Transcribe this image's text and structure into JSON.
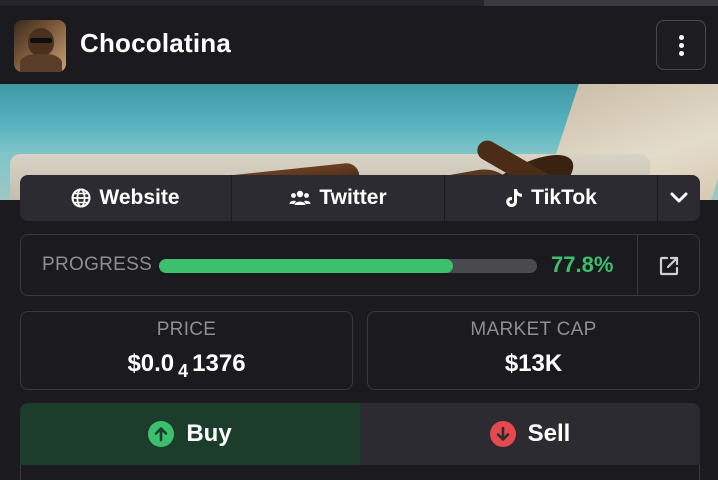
{
  "header": {
    "title": "Chocolatina",
    "menu_icon": "kebab-vertical-icon"
  },
  "socials": {
    "website": {
      "label": "Website",
      "icon": "globe-icon"
    },
    "twitter": {
      "label": "Twitter",
      "icon": "users-icon"
    },
    "tiktok": {
      "label": "TikTok",
      "icon": "tiktok-icon"
    },
    "more_icon": "chevron-down-icon"
  },
  "progress": {
    "label": "PROGRESS",
    "value_text": "77.8%",
    "fraction": 0.778,
    "external_icon": "external-link-icon"
  },
  "stats": {
    "price": {
      "label": "PRICE",
      "value_main": "$0.0",
      "value_sub": "4",
      "value_rest": "1376"
    },
    "market_cap": {
      "label": "MARKET CAP",
      "value": "$13K"
    }
  },
  "trade": {
    "buy_label": "Buy",
    "sell_label": "Sell"
  },
  "colors": {
    "accent_green": "#3cc06e",
    "sell_red": "#e5484d",
    "background": "#1b1a1f",
    "card_bg": "#2c2b31"
  }
}
